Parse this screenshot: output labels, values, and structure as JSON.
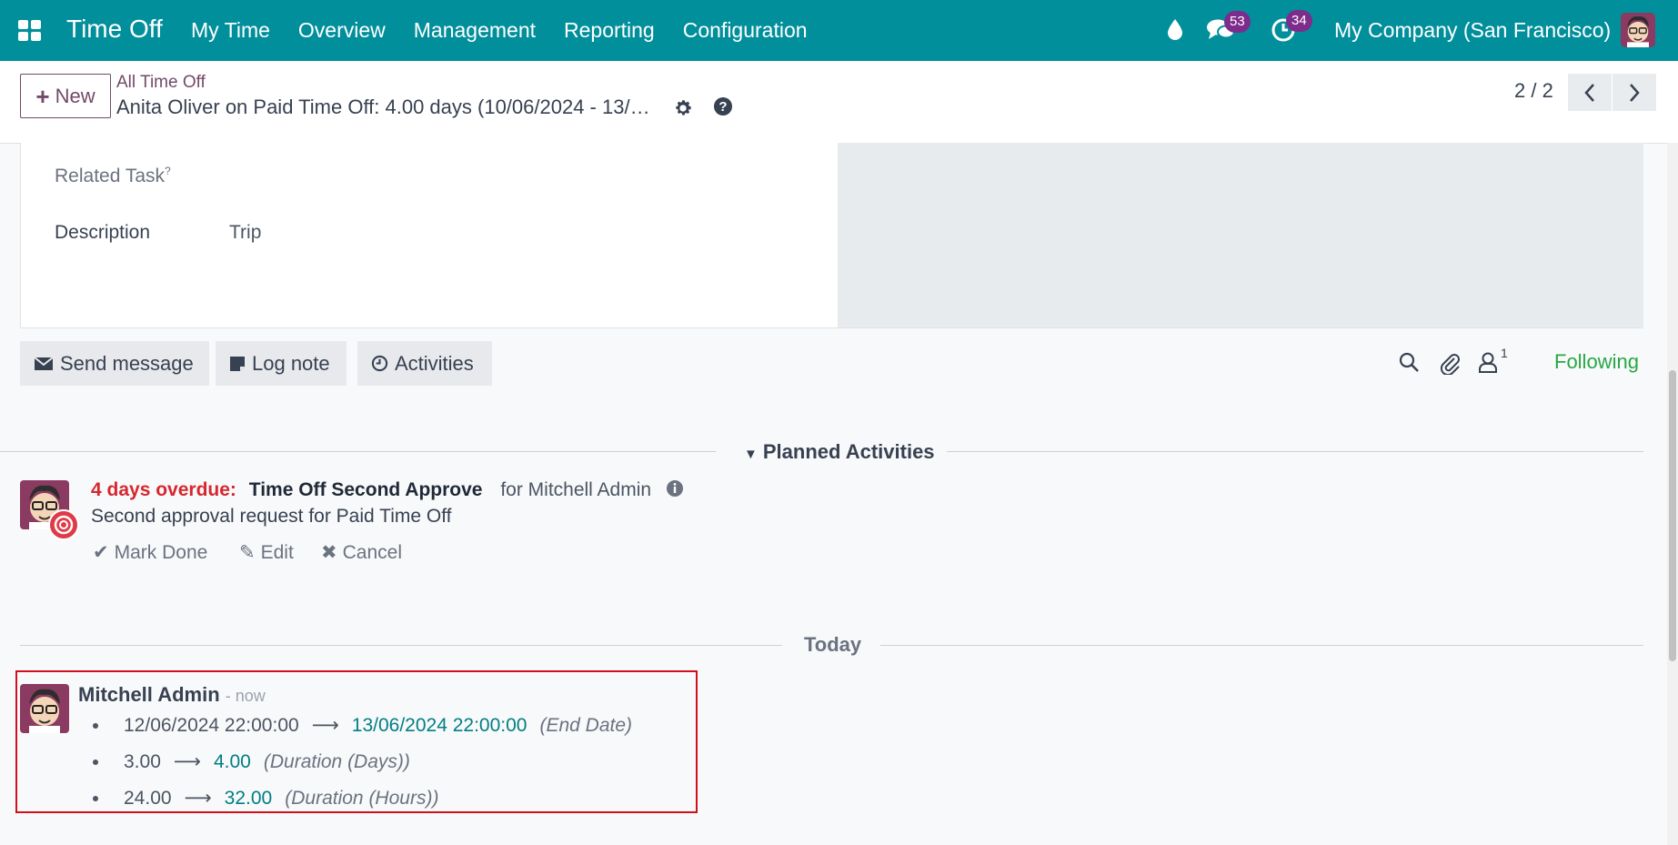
{
  "navbar": {
    "app_title": "Time Off",
    "menu": [
      "My Time",
      "Overview",
      "Management",
      "Reporting",
      "Configuration"
    ],
    "messages_count": "53",
    "activities_count": "34",
    "company": "My Company (San Francisco)"
  },
  "control": {
    "new_label": "New",
    "breadcrumb": "All Time Off",
    "record_title": "Anita Oliver on Paid Time Off: 4.00 days (10/06/2024 - 13/…",
    "pager": "2 / 2"
  },
  "form": {
    "related_task_label": "Related Task",
    "related_task_tooltip": "?",
    "description_label": "Description",
    "description_value": "Trip"
  },
  "chatter": {
    "send_message": "Send message",
    "log_note": "Log note",
    "activities": "Activities",
    "followers_count": "1",
    "following": "Following"
  },
  "planned": {
    "separator": "Planned Activities",
    "overdue": "4 days overdue:",
    "activity_name": "Time Off Second Approve",
    "assignee": "for Mitchell Admin",
    "summary": "Second approval request for Paid Time Off",
    "mark_done": "Mark Done",
    "edit": "Edit",
    "cancel": "Cancel"
  },
  "today": {
    "separator": "Today",
    "author": "Mitchell Admin",
    "time": "- now",
    "tracking": [
      {
        "old": "12/06/2024 22:00:00",
        "new": "13/06/2024 22:00:00",
        "field": "(End Date)"
      },
      {
        "old": "3.00",
        "new": "4.00",
        "field": "(Duration (Days))"
      },
      {
        "old": "24.00",
        "new": "32.00",
        "field": "(Duration (Hours))"
      }
    ]
  },
  "colors": {
    "navbar": "#018f9b",
    "brand": "#714b67",
    "overdue": "#d6272f",
    "following": "#28a745",
    "highlight_box": "#d20f1c",
    "tracking_new": "#017e84"
  }
}
